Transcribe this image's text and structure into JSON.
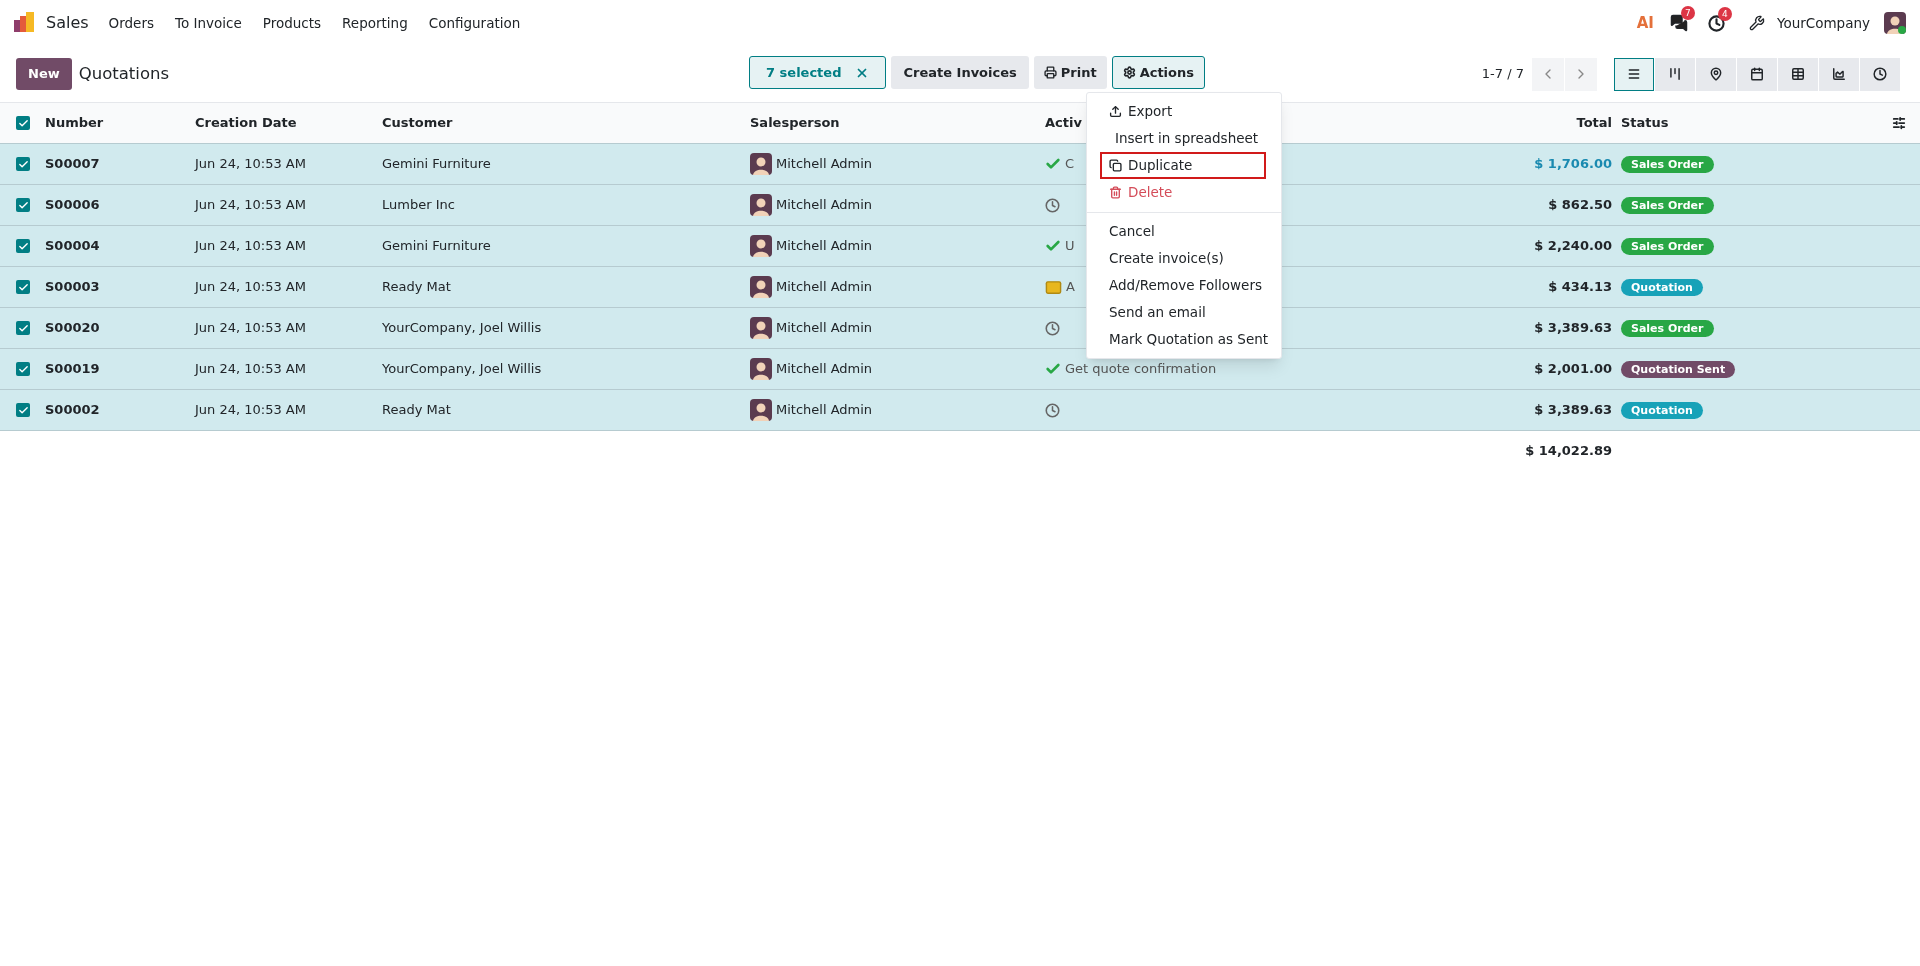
{
  "navbar": {
    "app": "Sales",
    "menu": [
      "Orders",
      "To Invoice",
      "Products",
      "Reporting",
      "Configuration"
    ],
    "ai": "AI",
    "messages_badge": "7",
    "activities_badge": "4",
    "company": "YourCompany"
  },
  "control_panel": {
    "new_button": "New",
    "title": "Quotations",
    "selection": "7 selected",
    "buttons": [
      "Create Invoices",
      "Print",
      "Actions"
    ],
    "pager": "1-7 / 7",
    "views": [
      {
        "kind": "list",
        "selected": true
      },
      {
        "kind": "kanban",
        "selected": false
      },
      {
        "kind": "map",
        "selected": false
      },
      {
        "kind": "calendar",
        "selected": false
      },
      {
        "kind": "pivot",
        "selected": false
      },
      {
        "kind": "graph",
        "selected": false
      },
      {
        "kind": "activity",
        "selected": false
      }
    ]
  },
  "table": {
    "select_all": true,
    "columns": [
      "Number",
      "Creation Date",
      "Customer",
      "Salesperson",
      "Activ",
      "Total",
      "Status"
    ],
    "rows": [
      {
        "checked": true,
        "number": "S00007",
        "date": "Jun 24, 10:53 AM",
        "customer": "Gemini Furniture",
        "salesperson": "Mitchell Admin",
        "activity": {
          "kind": "done",
          "text": "C"
        },
        "total": "$ 1,706.00",
        "total_highlight": true,
        "status": "Sales Order",
        "color": "#28a745"
      },
      {
        "checked": true,
        "number": "S00006",
        "date": "Jun 24, 10:53 AM",
        "customer": "Lumber Inc",
        "salesperson": "Mitchell Admin",
        "activity": {
          "kind": "clock"
        },
        "total": "$ 862.50",
        "total_highlight": false,
        "status": "Sales Order",
        "color": "#28a745"
      },
      {
        "checked": true,
        "number": "S00004",
        "date": "Jun 24, 10:53 AM",
        "customer": "Gemini Furniture",
        "salesperson": "Mitchell Admin",
        "activity": {
          "kind": "done",
          "text": "U"
        },
        "total": "$ 2,240.00",
        "total_highlight": false,
        "status": "Sales Order",
        "color": "#28a745"
      },
      {
        "checked": true,
        "number": "S00003",
        "date": "Jun 24, 10:53 AM",
        "customer": "Ready Mat",
        "salesperson": "Mitchell Admin",
        "activity": {
          "kind": "mail",
          "text": "A"
        },
        "total": "$ 434.13",
        "total_highlight": false,
        "status": "Quotation",
        "color": "#17a2b8"
      },
      {
        "checked": true,
        "number": "S00020",
        "date": "Jun 24, 10:53 AM",
        "customer": "YourCompany, Joel Willis",
        "salesperson": "Mitchell Admin",
        "activity": {
          "kind": "clock"
        },
        "total": "$ 3,389.63",
        "total_highlight": false,
        "status": "Sales Order",
        "color": "#28a745"
      },
      {
        "checked": true,
        "number": "S00019",
        "date": "Jun 24, 10:53 AM",
        "customer": "YourCompany, Joel Willis",
        "salesperson": "Mitchell Admin",
        "activity": {
          "kind": "done",
          "text": "Get quote confirmation"
        },
        "total": "$ 2,001.00",
        "total_highlight": false,
        "status": "Quotation Sent",
        "color": "#714b67"
      },
      {
        "checked": true,
        "number": "S00002",
        "date": "Jun 24, 10:53 AM",
        "customer": "Ready Mat",
        "salesperson": "Mitchell Admin",
        "activity": {
          "kind": "clock"
        },
        "total": "$ 3,389.63",
        "total_highlight": false,
        "status": "Quotation",
        "color": "#17a2b8"
      }
    ],
    "sum": "$ 14,022.89"
  },
  "actions_menu": {
    "groups": [
      [
        {
          "label": "Export",
          "kind": "export",
          "highlighted": false
        },
        {
          "label": "Insert in spreadsheet",
          "kind": "spreadsheet",
          "highlighted": false
        },
        {
          "label": "Duplicate",
          "kind": "duplicate",
          "highlighted": true
        },
        {
          "label": "Delete",
          "kind": "delete",
          "highlighted": false
        }
      ],
      [
        {
          "label": "Cancel",
          "kind": "plain",
          "highlighted": false
        },
        {
          "label": "Create invoice(s)",
          "kind": "plain",
          "highlighted": false
        },
        {
          "label": "Add/Remove Followers",
          "kind": "plain",
          "highlighted": false
        },
        {
          "label": "Send an email",
          "kind": "plain",
          "highlighted": false
        },
        {
          "label": "Mark Quotation as Sent",
          "kind": "plain",
          "highlighted": false
        }
      ]
    ]
  }
}
